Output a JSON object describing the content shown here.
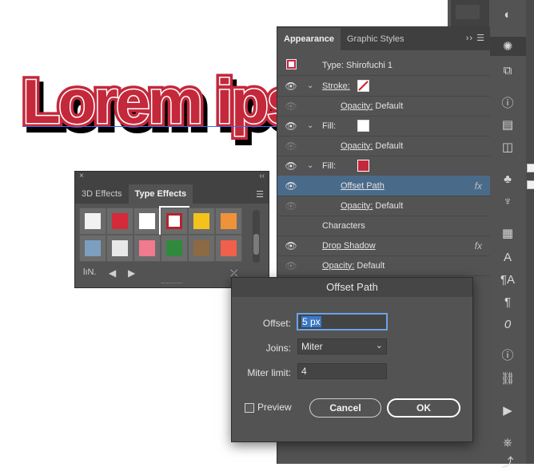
{
  "canvas": {
    "artwork_text": "Lorem ips",
    "colors": {
      "fill": "#c4283b",
      "shadow": "#000000",
      "inner_stroke": "#ffffff",
      "baseline": "#3a6cf0"
    }
  },
  "appearance_panel": {
    "tabs": [
      {
        "label": "Appearance",
        "active": true
      },
      {
        "label": "Graphic Styles",
        "active": false
      }
    ],
    "menu_icons": "›› ☰",
    "rows": [
      {
        "type": "header",
        "label": "Type: Shirofuchi 1"
      },
      {
        "type": "stroke",
        "label": "Stroke:",
        "swatch": "none-slash"
      },
      {
        "type": "opacity",
        "label": "Opacity:",
        "value": "Default"
      },
      {
        "type": "fill",
        "label": "Fill:",
        "swatch": "#ffffff"
      },
      {
        "type": "opacity",
        "label": "Opacity:",
        "value": "Default"
      },
      {
        "type": "fill",
        "label": "Fill:",
        "swatch": "#c4283b"
      },
      {
        "type": "effect",
        "label": "Offset Path",
        "selected": true
      },
      {
        "type": "opacity",
        "label": "Opacity:",
        "value": "Default"
      },
      {
        "type": "characters",
        "label": "Characters"
      },
      {
        "type": "effect",
        "label": "Drop Shadow"
      },
      {
        "type": "opacity",
        "label": "Opacity:",
        "value": "Default"
      }
    ],
    "fx_label": "fx"
  },
  "type_effects_panel": {
    "close_glyph": "×",
    "collapse_glyph": "‹‹",
    "tabs": [
      {
        "label": "3D Effects",
        "active": false
      },
      {
        "label": "Type Effects",
        "active": true
      }
    ],
    "menu_icon": "☰",
    "styles": [
      {
        "name": "style-white-bevel",
        "color": "#f2f2f2",
        "selected": false
      },
      {
        "name": "style-red-brush",
        "color": "#d42a3a",
        "selected": false
      },
      {
        "name": "style-white-shadow",
        "color": "#ffffff",
        "selected": false
      },
      {
        "name": "style-red-outline",
        "color": "#ffffff",
        "selected": true
      },
      {
        "name": "style-yellow-blue",
        "color": "#f3c31b",
        "selected": false
      },
      {
        "name": "style-orange",
        "color": "#f0923a",
        "selected": false
      },
      {
        "name": "style-blue-gradient",
        "color": "#7c9fc0",
        "selected": false
      },
      {
        "name": "style-light-gray",
        "color": "#e8e8e8",
        "selected": false
      },
      {
        "name": "style-pink-orange",
        "color": "#f07a8e",
        "selected": false
      },
      {
        "name": "style-green-leaf",
        "color": "#2f8a3d",
        "selected": false
      },
      {
        "name": "style-wood",
        "color": "#8c6a43",
        "selected": false
      },
      {
        "name": "style-coral",
        "color": "#f0604a",
        "selected": false
      }
    ],
    "footer_icons": {
      "library": "lıN.",
      "prev": "◀",
      "next": "▶",
      "break": "⤫"
    }
  },
  "dialog": {
    "title": "Offset Path",
    "offset": {
      "label": "Offset:",
      "value": "5 px"
    },
    "joins": {
      "label": "Joins:",
      "value": "Miter"
    },
    "miter_limit": {
      "label": "Miter limit:",
      "value": "4"
    },
    "preview_label": "Preview",
    "cancel_label": "Cancel",
    "ok_label": "OK"
  },
  "toolbar": {
    "icons": [
      "layers-icon",
      "sun-icon",
      "transform-icon",
      "info-icon",
      "align-icon",
      "pathfinder-icon",
      "club-icon",
      "plant-icon",
      "grid-icon",
      "type-icon",
      "paragraph-style-icon",
      "character-style-icon",
      "opentype-icon",
      "document-icon",
      "link-icon",
      "play-icon",
      "navigator-icon",
      "export-icon"
    ],
    "glyphs": [
      "◐",
      "✺",
      "⧉",
      "ⓘ",
      "▤",
      "◫",
      "♣",
      "♆",
      "▦",
      "A",
      "¶A",
      "¶",
      "0",
      "ⓘ",
      "⛓",
      "▶",
      "⎈",
      "⤴"
    ]
  }
}
